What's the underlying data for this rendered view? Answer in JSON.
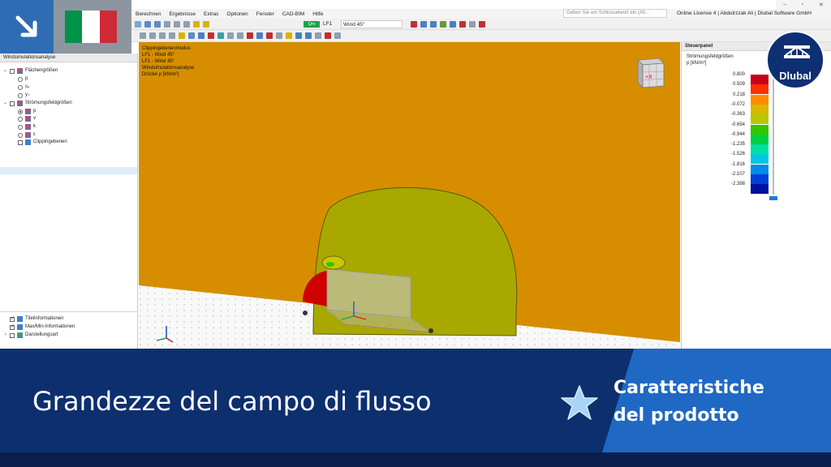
{
  "menu": [
    "Berechnen",
    "Ergebnisse",
    "Extras",
    "Optionen",
    "Fenster",
    "CAD-BIM",
    "Hilfe"
  ],
  "search_placeholder": "Geben Sie ein Schlüsselwort ein (Alt...",
  "license": "Online License 4 | Abdulrzzak Ali | Dlubal Software GmbH",
  "window_controls": [
    "–",
    "▫",
    "✕"
  ],
  "loadcase": {
    "badge": "Qm",
    "code": "LF1",
    "name": "Wind 45°"
  },
  "navigator": {
    "title": "Windsimulationsanalyse",
    "tree": [
      {
        "label": "Flächengrößen",
        "kind": "group"
      },
      {
        "label": "p",
        "kind": "radio"
      },
      {
        "label": "cₚ",
        "kind": "radio"
      },
      {
        "label": "y₊",
        "kind": "radio"
      },
      {
        "label": "Strömungsfeldgrößen",
        "kind": "group"
      },
      {
        "label": "p",
        "kind": "radio",
        "selected": true
      },
      {
        "label": "v",
        "kind": "radio",
        "highlighted": true
      },
      {
        "label": "k",
        "kind": "radio"
      },
      {
        "label": "ε",
        "kind": "radio"
      },
      {
        "label": "Clippingebenen",
        "kind": "checkbox"
      }
    ],
    "lower": [
      {
        "label": "Titelinformationen",
        "checked": true
      },
      {
        "label": "Max/Min-Informationen",
        "checked": true
      },
      {
        "label": "Darstellungsart",
        "checked": false
      }
    ]
  },
  "viewport": {
    "info_lines": [
      "Clippingebenenmodus",
      "LF1 - Wind 45°",
      "LF1 - Wind 45°",
      "Windsimulationsanalyse",
      "Drücke p [kN/m²]"
    ],
    "cube_label": "+X"
  },
  "panel": {
    "title": "Steuerpanel",
    "legend_title": "Strömungsfeldgrößen",
    "legend_unit": "p [kN/m²]",
    "legend": [
      {
        "value": "0.800",
        "color": "#c8001a"
      },
      {
        "value": "0.509",
        "color": "#ff3000"
      },
      {
        "value": "0.218",
        "color": "#ff8c00"
      },
      {
        "value": "-0.072",
        "color": "#d8b800"
      },
      {
        "value": "-0.363",
        "color": "#b8c800"
      },
      {
        "value": "-0.654",
        "color": "#2ec800"
      },
      {
        "value": "-0.944",
        "color": "#00d040"
      },
      {
        "value": "-1.235",
        "color": "#00e0a0"
      },
      {
        "value": "-1.526",
        "color": "#00c8e0"
      },
      {
        "value": "-1.816",
        "color": "#008ce8"
      },
      {
        "value": "-2.107",
        "color": "#0040d8"
      },
      {
        "value": "-2.398",
        "color": "#0010a0"
      }
    ]
  },
  "logo_text": "Dlubal",
  "banner": {
    "title": "Grandezze del campo di flusso",
    "subtitle_line1": "Caratteristiche",
    "subtitle_line2": "del prodotto"
  },
  "flag_colors": [
    "#009246",
    "#ffffff",
    "#ce2b37"
  ],
  "colors": {
    "accent_blue": "#2e6db4",
    "banner_navy": "#0d2f6e",
    "banner_blue": "#1f68c4",
    "ground_orange": "#d68e00",
    "contour_olive": "#a8a800"
  }
}
